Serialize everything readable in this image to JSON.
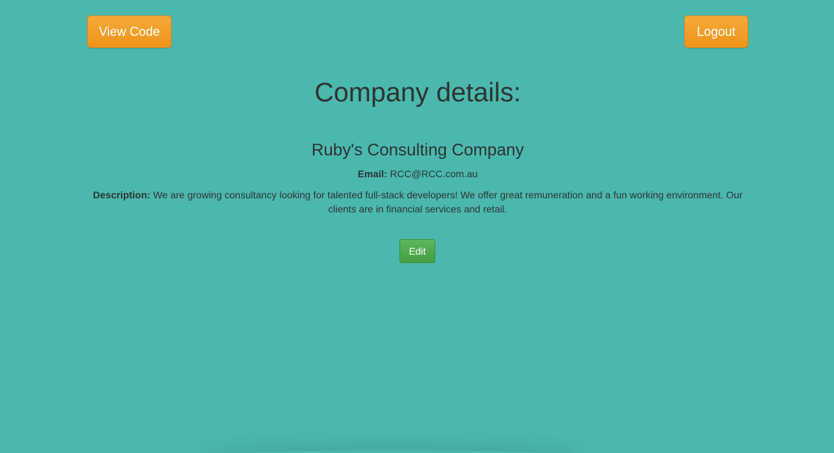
{
  "header": {
    "view_code_label": "View Code",
    "logout_label": "Logout"
  },
  "page": {
    "title": "Company details:"
  },
  "company": {
    "name": "Ruby's Consulting Company",
    "email_label": "Email:",
    "email_value": "RCC@RCC.com.au",
    "description_label": "Description:",
    "description_value": "We are growing consultancy looking for talented full-stack developers! We offer great remuneration and a fun working environment. Our clients are in financial services and retail."
  },
  "actions": {
    "edit_label": "Edit"
  },
  "colors": {
    "background": "#4bb8ad",
    "primary_button": "#ee9418",
    "edit_button": "#449d44",
    "text": "#2e3333"
  }
}
